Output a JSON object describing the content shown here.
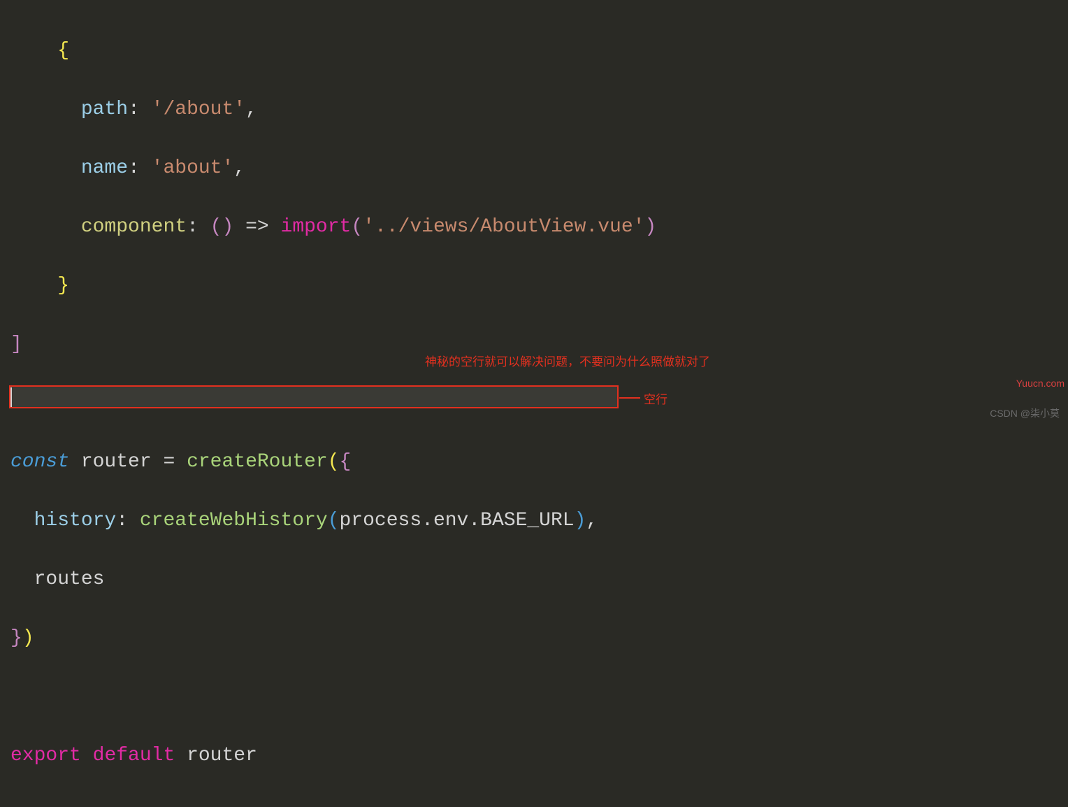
{
  "code": {
    "line1_brace": "{",
    "line2_indent": "      ",
    "line2_path": "path",
    "line2_colon": ": ",
    "line2_string": "'/about'",
    "line2_comma": ",",
    "line3_indent": "      ",
    "line3_name": "name",
    "line3_colon": ": ",
    "line3_string": "'about'",
    "line3_comma": ",",
    "line4_indent": "      ",
    "line4_component": "component",
    "line4_colon": ": ",
    "line4_paren_open": "(",
    "line4_paren_close": ") ",
    "line4_arrow": "=> ",
    "line4_import": "import",
    "line4_paren2_open": "(",
    "line4_string": "'../views/AboutView.vue'",
    "line4_paren2_close": ")",
    "line5_indent": "    ",
    "line5_brace": "}",
    "line6_bracket": "]",
    "line8_const": "const",
    "line8_space": " ",
    "line8_router": "router ",
    "line8_eq": "= ",
    "line8_createRouter": "createRouter",
    "line8_paren_open": "(",
    "line8_brace_open": "{",
    "line9_indent": "  ",
    "line9_history": "history",
    "line9_colon": ": ",
    "line9_createWebHistory": "createWebHistory",
    "line9_paren_open": "(",
    "line9_process": "process",
    "line9_dot1": ".",
    "line9_env": "env",
    "line9_dot2": ".",
    "line9_baseurl": "BASE_URL",
    "line9_paren_close": ")",
    "line9_comma": ",",
    "line10_indent": "  ",
    "line10_routes": "routes",
    "line11_brace": "}",
    "line11_paren": ")",
    "line13_export": "export",
    "line13_space1": " ",
    "line13_default": "default",
    "line13_space2": " ",
    "line13_router": "router"
  },
  "annotations": {
    "top_text": "神秘的空行就可以解决问题，不要问为什么照做就对了",
    "label_text": "空行"
  },
  "watermarks": {
    "csdn": "CSDN @柒小莫",
    "yuucn": "Yuucn.com"
  }
}
